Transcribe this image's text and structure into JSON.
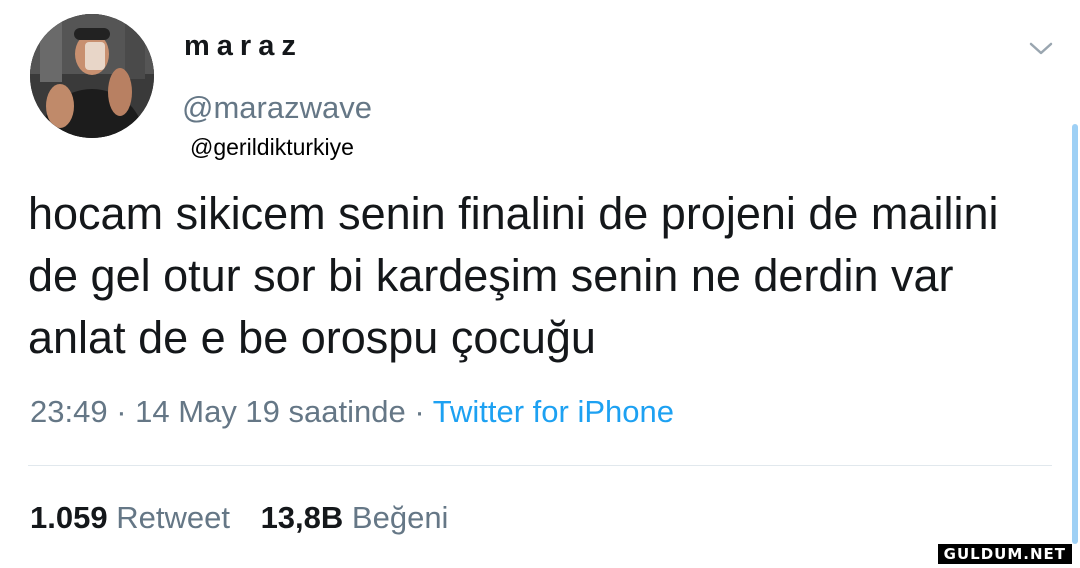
{
  "tweet": {
    "display_name": "maraz",
    "handle": "@marazwave",
    "watermark_handle": "@gerildikturkiye",
    "text": "hocam sikicem senin finalini de projeni de mailini de gel otur sor bi kardeşim senin ne derdin var anlat de e be orospu çocuğu",
    "time": "23:49",
    "separator": "·",
    "date": "14 May 19 saatinde",
    "source": "Twitter for iPhone",
    "retweet_count": "1.059",
    "retweet_label": "Retweet",
    "like_count": "13,8B",
    "like_label": "Beğeni"
  },
  "icons": {
    "menu": "chevron-down-icon"
  },
  "site_watermark": "GULDUM.NET",
  "colors": {
    "text": "#14171a",
    "secondary": "#657786",
    "link": "#1da1f2",
    "divider": "#e1e8ed"
  }
}
